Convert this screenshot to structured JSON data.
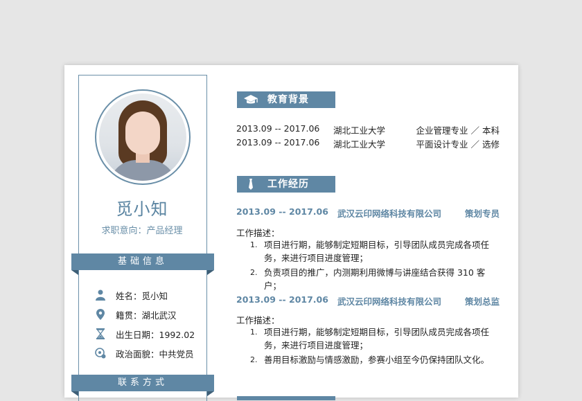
{
  "profile": {
    "name": "觅小知",
    "intent": "求职意向：产品经理"
  },
  "sections": {
    "basic": "基础信息",
    "contact": "联系方式",
    "education": "教育背景",
    "work": "工作经历"
  },
  "basic_info": [
    {
      "icon": "person-icon",
      "label": "姓名：觅小知"
    },
    {
      "icon": "location-pin-icon",
      "label": "籍贯：湖北武汉"
    },
    {
      "icon": "hourglass-icon",
      "label": "出生日期：1992.02"
    },
    {
      "icon": "badge-icon",
      "label": "政治面貌：中共党员"
    }
  ],
  "education": [
    {
      "period": "2013.09 -- 2017.06",
      "school": "湖北工业大学",
      "major": "企业管理专业 ／ 本科"
    },
    {
      "period": "2013.09 -- 2017.06",
      "school": "湖北工业大学",
      "major": "平面设计专业 ／ 选修"
    }
  ],
  "work": [
    {
      "period": "2013.09 -- 2017.06",
      "company": "武汉云印网络科技有限公司",
      "role": "策划专员",
      "desc_label": "工作描述：",
      "items": [
        {
          "num": "1.",
          "text": "项目进行期，能够制定短期目标，引导团队成员完成各项任务，来进行项目进度管理；"
        },
        {
          "num": "2.",
          "text": "负责项目的推广，内测期利用微博与讲座结合获得 310 客户；"
        }
      ]
    },
    {
      "period": "2013.09 -- 2017.06",
      "company": "武汉云印网络科技有限公司",
      "role": "策划总监",
      "desc_label": "工作描述：",
      "items": [
        {
          "num": "1.",
          "text": "项目进行期，能够制定短期目标，引导团队成员完成各项任务，来进行项目进度管理；"
        },
        {
          "num": "2.",
          "text": "善用目标激励与情感激励，参赛小组至今仍保持团队文化。"
        }
      ]
    }
  ],
  "colors": {
    "accent": "#5f87a4",
    "ribbon_fold": "#3e5f77"
  }
}
